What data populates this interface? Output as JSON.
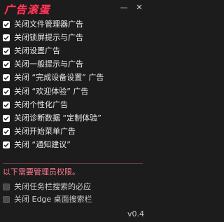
{
  "window": {
    "title": "广告滚蛋",
    "minimize_glyph": "—",
    "close_glyph": "✕"
  },
  "options": [
    {
      "label": "关闭文件管理器广告",
      "checked": true
    },
    {
      "label": "关闭锁屏提示与广告",
      "checked": true
    },
    {
      "label": "关闭设置广告",
      "checked": true
    },
    {
      "label": "关闭一般提示与广告",
      "checked": true
    },
    {
      "label": "关闭 “完成设备设置” 广告",
      "checked": true
    },
    {
      "label": "关闭 “欢迎体验” 广告",
      "checked": true
    },
    {
      "label": "关闭个性化广告",
      "checked": true
    },
    {
      "label": "关闭诊断数据 “定制体验”",
      "checked": true
    },
    {
      "label": "关闭开始菜单广告",
      "checked": true
    },
    {
      "label": "关闭 “通知建议”",
      "checked": true
    }
  ],
  "admin": {
    "note": "以下需要管理员权限。",
    "options": [
      {
        "label": "关闭任务栏搜索的必应",
        "checked": false
      },
      {
        "label": "关闭 Edge 桌面搜索栏",
        "checked": false
      }
    ]
  },
  "version": "v0.4",
  "colors": {
    "accent": "#ff3a5c",
    "background": "#1c1c1c",
    "admin_note": "#ff7a8e"
  }
}
